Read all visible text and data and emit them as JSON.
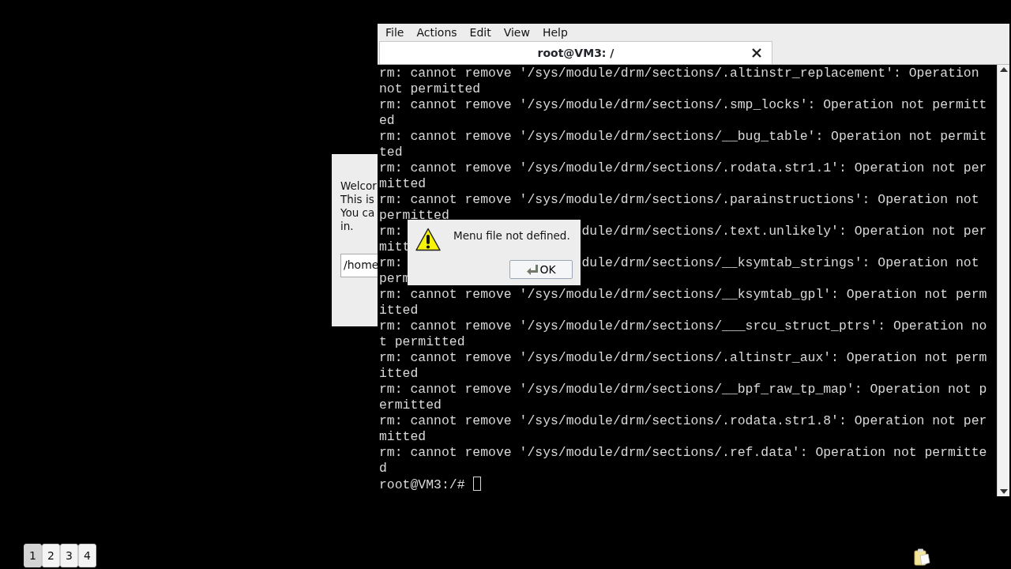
{
  "background_window": {
    "lines": [
      "Welcor",
      "This is",
      "You ca",
      "in."
    ],
    "field_value": "/home"
  },
  "terminal": {
    "menu": [
      "File",
      "Actions",
      "Edit",
      "View",
      "Help"
    ],
    "tab": {
      "title": "root@VM3: /"
    },
    "lines": [
      {
        "kind": "full",
        "text": "rm: cannot remove '/sys/module/drm/sections/.altinstr_replacement': Operation"
      },
      {
        "kind": "full",
        "text": "not permitted"
      },
      {
        "kind": "full",
        "text": "rm: cannot remove '/sys/module/drm/sections/.smp_locks': Operation not permitt"
      },
      {
        "kind": "full",
        "text": "ed"
      },
      {
        "kind": "full",
        "text": "rm: cannot remove '/sys/module/drm/sections/__bug_table': Operation not permit"
      },
      {
        "kind": "full",
        "text": "ted"
      },
      {
        "kind": "full",
        "text": "rm: cannot remove '/sys/module/drm/sections/.rodata.str1.1': Operation not per"
      },
      {
        "kind": "full",
        "text": "mitted"
      },
      {
        "kind": "full",
        "text": "rm: cannot remove '/sys/module/drm/sections/.parainstructions': Operation not"
      },
      {
        "kind": "full",
        "text": "permitted"
      },
      {
        "kind": "covered",
        "left": "rm:",
        "right": "dule/drm/sections/.text.unlikely': Operation not per"
      },
      {
        "kind": "covered",
        "left": "mitt"
      },
      {
        "kind": "covered",
        "left": "rm:",
        "right": "dule/drm/sections/__ksymtab_strings': Operation not"
      },
      {
        "kind": "covered",
        "left": "perm"
      },
      {
        "kind": "full",
        "text": "rm: cannot remove '/sys/module/drm/sections/__ksymtab_gpl': Operation not perm"
      },
      {
        "kind": "full",
        "text": "itted"
      },
      {
        "kind": "full",
        "text": "rm: cannot remove '/sys/module/drm/sections/___srcu_struct_ptrs': Operation no"
      },
      {
        "kind": "full",
        "text": "t permitted"
      },
      {
        "kind": "full",
        "text": "rm: cannot remove '/sys/module/drm/sections/.altinstr_aux': Operation not perm"
      },
      {
        "kind": "full",
        "text": "itted"
      },
      {
        "kind": "full",
        "text": "rm: cannot remove '/sys/module/drm/sections/__bpf_raw_tp_map': Operation not p"
      },
      {
        "kind": "full",
        "text": "ermitted"
      },
      {
        "kind": "full",
        "text": "rm: cannot remove '/sys/module/drm/sections/.rodata.str1.8': Operation not per"
      },
      {
        "kind": "full",
        "text": "mitted"
      },
      {
        "kind": "full",
        "text": "rm: cannot remove '/sys/module/drm/sections/.ref.data': Operation not permitte"
      },
      {
        "kind": "full",
        "text": "d"
      }
    ],
    "prompt": "root@VM3:/#"
  },
  "dialog": {
    "message": "Menu file not defined.",
    "button": "OK"
  },
  "workspaces": [
    {
      "label": "1",
      "selected": true
    },
    {
      "label": "2",
      "selected": false
    },
    {
      "label": "3",
      "selected": false
    },
    {
      "label": "4",
      "selected": false
    }
  ]
}
